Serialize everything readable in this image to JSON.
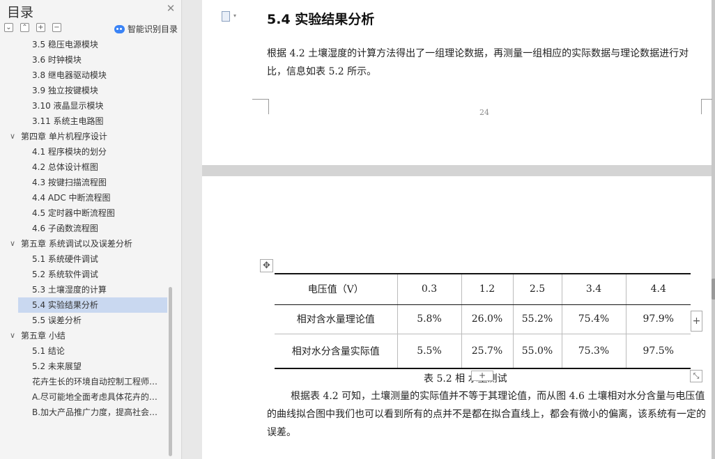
{
  "outline": {
    "title": "目录",
    "smart_label": "智能识别目录",
    "items": [
      {
        "label": "3.5 稳压电源模块",
        "level": 2
      },
      {
        "label": "3.6 时钟模块",
        "level": 2
      },
      {
        "label": "3.8 继电器驱动模块",
        "level": 2
      },
      {
        "label": "3.9 独立按键模块",
        "level": 2
      },
      {
        "label": "3.10 液晶显示模块",
        "level": 2
      },
      {
        "label": "3.11 系统主电路图",
        "level": 2
      },
      {
        "label": "第四章  单片机程序设计",
        "level": 1
      },
      {
        "label": "4.1 程序模块的划分",
        "level": 2
      },
      {
        "label": "4.2 总体设计框图",
        "level": 2
      },
      {
        "label": "4.3 按键扫描流程图",
        "level": 2
      },
      {
        "label": "4.4 ADC 中断流程图",
        "level": 2
      },
      {
        "label": "4.5  定时器中断流程图",
        "level": 2
      },
      {
        "label": "4.6 子函数流程图",
        "level": 2
      },
      {
        "label": "第五章  系统调试以及误差分析",
        "level": 1
      },
      {
        "label": "5.1  系统硬件调试",
        "level": 2
      },
      {
        "label": "5.2  系统软件调试",
        "level": 2
      },
      {
        "label": "5.3 土壤湿度的计算",
        "level": 2
      },
      {
        "label": "5.4 实验结果分析",
        "level": 2
      },
      {
        "label": "5.5 误差分析",
        "level": 2
      },
      {
        "label": "第五章  小结",
        "level": 1
      },
      {
        "label": "5.1 结论",
        "level": 2
      },
      {
        "label": "5.2  未来展望",
        "level": 2
      },
      {
        "label": "花卉生长的环境自动控制工程师…",
        "level": 0
      },
      {
        "label": "A.尽可能地全面考虑具体花卉的…",
        "level": 0
      },
      {
        "label": "B.加大产品推广力度，提高社会…",
        "level": 0
      }
    ]
  },
  "document": {
    "heading": "5.4 实验结果分析",
    "para1": "根据 4.2 土壤湿度的计算方法得出了一组理论数据，再测量一组相应的实际数据与理论数据进行对比，信息如表 5.2 所示。",
    "page_number": "24",
    "table": {
      "header": [
        "电压值（V）",
        "0.3",
        "1.2",
        "2.5",
        "3.4",
        "4.4"
      ],
      "row1": [
        "相对含水量理论值",
        "5.8%",
        "26.0%",
        "55.2%",
        "75.4%",
        "97.9%"
      ],
      "row2": [
        "相对水分含量实际值",
        "5.5%",
        "25.7%",
        "55.0%",
        "75.3%",
        "97.5%"
      ]
    },
    "caption": "表 5.2 相     水量测试",
    "para2": "根据表 4.2 可知，土壤测量的实际值并不等于其理论值，而从图 4.6 土壤相对水分含量与电压值的曲线拟合图中我们也可以看到所有的点并不是都在拟合直线上，都会有微小的偏离，该系统有一定的误差。"
  }
}
